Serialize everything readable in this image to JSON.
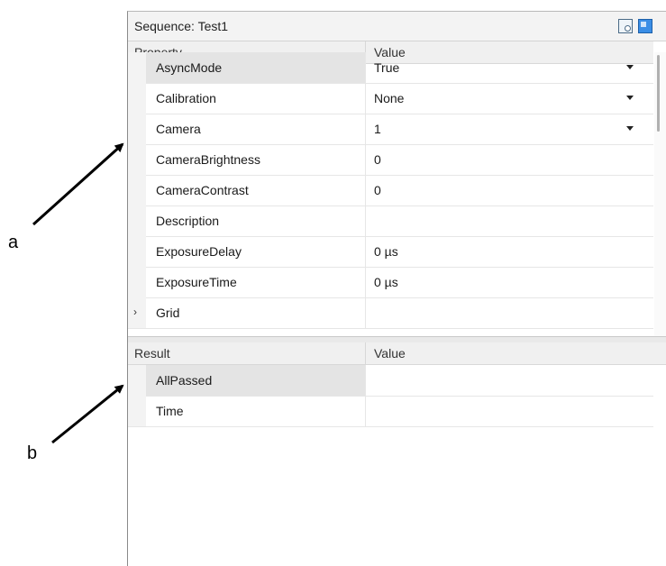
{
  "panel": {
    "title": "Sequence: Test1",
    "toolbar_icons": [
      "properties-icon",
      "panel-layout-icon"
    ]
  },
  "properties": {
    "columns": [
      "Property",
      "Value"
    ],
    "rows": [
      {
        "name": "AsyncMode",
        "value": "True",
        "dropdown": true,
        "selected": true
      },
      {
        "name": "Calibration",
        "value": "None",
        "dropdown": true
      },
      {
        "name": "Camera",
        "value": "1",
        "dropdown": true
      },
      {
        "name": "CameraBrightness",
        "value": "0"
      },
      {
        "name": "CameraContrast",
        "value": "0"
      },
      {
        "name": "Description",
        "value": ""
      },
      {
        "name": "ExposureDelay",
        "value": "0  µs"
      },
      {
        "name": "ExposureTime",
        "value": "0  µs"
      },
      {
        "name": "Grid",
        "value": "",
        "expandable": true
      }
    ]
  },
  "results": {
    "columns": [
      "Result",
      "Value"
    ],
    "rows": [
      {
        "name": "AllPassed",
        "value": "",
        "selected": true
      },
      {
        "name": "Time",
        "value": ""
      }
    ]
  },
  "annotations": {
    "a": "a",
    "b": "b"
  },
  "colors": {
    "accent": "#3a8ee6",
    "selected_row": "#e4e4e4",
    "header": "#f0f0f0"
  }
}
